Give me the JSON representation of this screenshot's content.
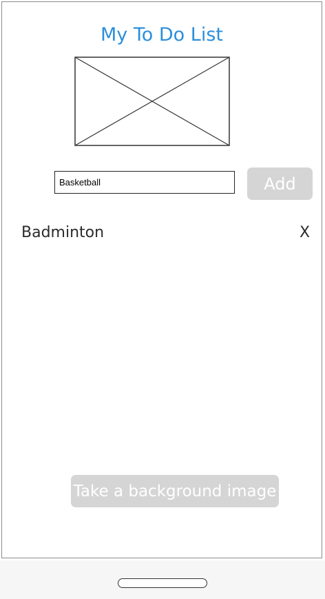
{
  "app": {
    "title": "My To Do List"
  },
  "image_placeholder": {
    "icon": "image-placeholder-icon"
  },
  "input": {
    "value": "Basketball"
  },
  "buttons": {
    "add_label": "Add",
    "background_label": "Take a background image"
  },
  "todos": [
    {
      "label": "Badminton",
      "delete_label": "X"
    }
  ],
  "colors": {
    "title": "#2b8fdc",
    "button_bg": "#d5d5d5",
    "button_text": "#ffffff"
  }
}
